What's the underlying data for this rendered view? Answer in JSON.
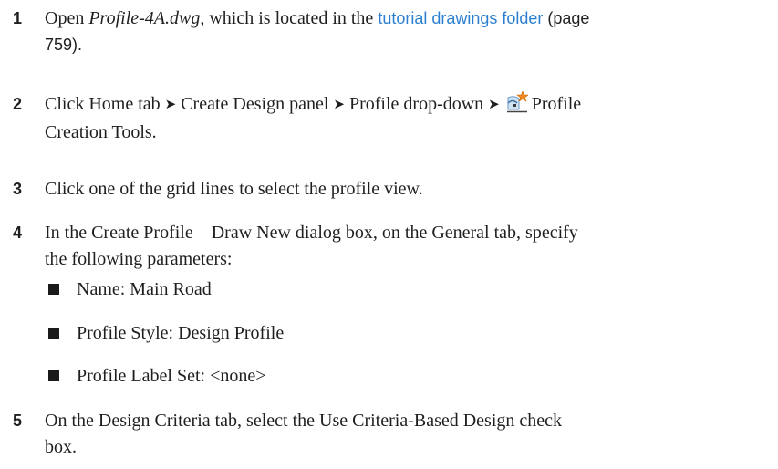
{
  "steps": [
    {
      "number": "1",
      "text_before": "Open ",
      "filename": "Profile-4A.dwg",
      "text_mid": ", which is located in the ",
      "link": "tutorial drawings folder",
      "page_ref_open": " (page",
      "page_ref_close": "759)."
    },
    {
      "number": "2",
      "parts": [
        "Click Home tab",
        "Create Design panel",
        "Profile drop-down"
      ],
      "arrow_glyph": "➤",
      "icon": "profile-creation-tools-icon",
      "tail_line1": "Profile",
      "tail_line2": "Creation Tools."
    },
    {
      "number": "3",
      "text": "Click one of the grid lines to select the profile view."
    },
    {
      "number": "4",
      "line1": "In the Create Profile – Draw New dialog box, on the General tab, specify",
      "line2": "the following parameters:",
      "bullets": [
        "Name: Main Road",
        "Profile Style: Design Profile",
        "Profile Label Set: <none>"
      ]
    },
    {
      "number": "5",
      "line1": "On the Design Criteria tab, select the Use Criteria-Based Design check",
      "line2": "box."
    }
  ],
  "colors": {
    "link": "#2c7fd0",
    "text": "#1f1f1f",
    "icon_star": "#f08a1c"
  }
}
